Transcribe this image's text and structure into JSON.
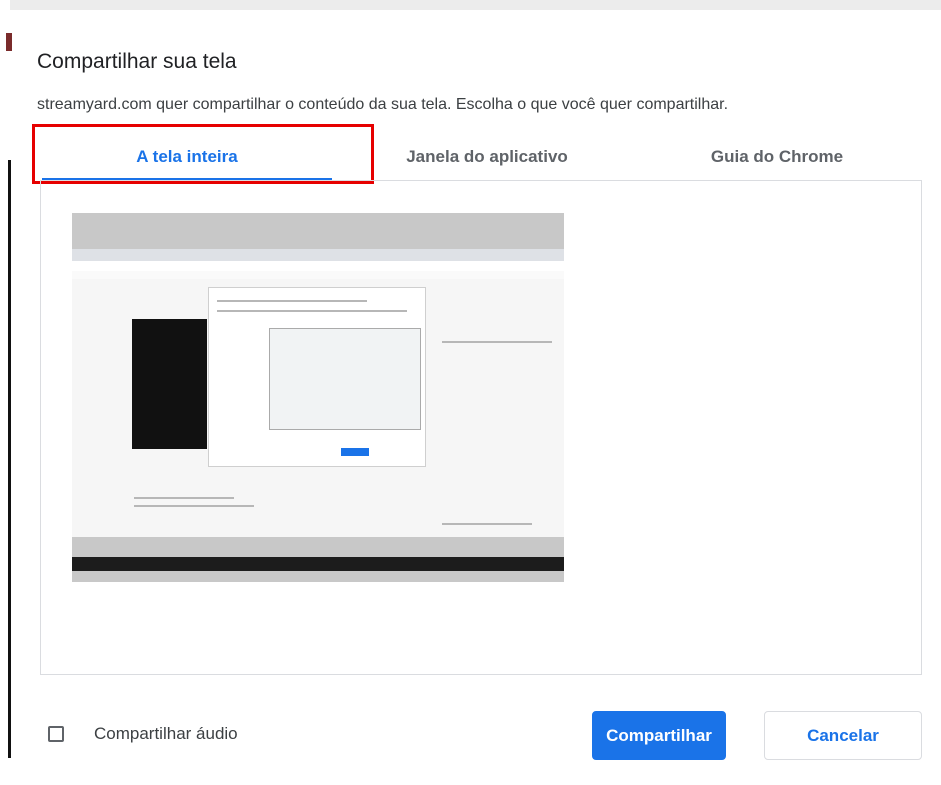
{
  "dialog": {
    "title": "Compartilhar sua tela",
    "subtitle": "streamyard.com quer compartilhar o conteúdo da sua tela. Escolha o que você quer compartilhar."
  },
  "tabs": [
    {
      "label": "A tela inteira",
      "active": true
    },
    {
      "label": "Janela do aplicativo",
      "active": false
    },
    {
      "label": "Guia do Chrome",
      "active": false
    }
  ],
  "footer": {
    "audio_label": "Compartilhar áudio",
    "audio_checked": false,
    "share_label": "Compartilhar",
    "cancel_label": "Cancelar"
  },
  "colors": {
    "accent": "#1a73e8",
    "highlight": "#e60000"
  }
}
